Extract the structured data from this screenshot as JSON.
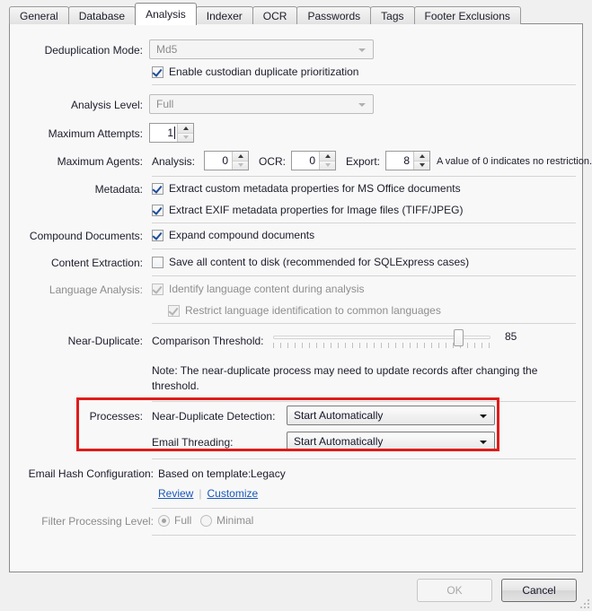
{
  "tabs": [
    {
      "label": "General",
      "selected": false
    },
    {
      "label": "Database",
      "selected": false
    },
    {
      "label": "Analysis",
      "selected": true
    },
    {
      "label": "Indexer",
      "selected": false
    },
    {
      "label": "OCR",
      "selected": false
    },
    {
      "label": "Passwords",
      "selected": false
    },
    {
      "label": "Tags",
      "selected": false
    },
    {
      "label": "Footer Exclusions",
      "selected": false
    }
  ],
  "form": {
    "deduplication": {
      "label": "Deduplication Mode:",
      "value": "Md5",
      "enabled": false
    },
    "custodian": {
      "label": "Enable custodian duplicate prioritization",
      "checked": true
    },
    "analysis_level": {
      "label": "Analysis Level:",
      "value": "Full",
      "enabled": false
    },
    "maximum_attempts": {
      "label": "Maximum Attempts:",
      "value": "1"
    },
    "maximum_agents": {
      "label": "Maximum Agents:",
      "analysis_label": "Analysis:",
      "analysis_value": "0",
      "ocr_label": "OCR:",
      "ocr_value": "0",
      "export_label": "Export:",
      "export_value": "8",
      "hint": "A value of 0 indicates no restriction."
    },
    "metadata": {
      "label": "Metadata:",
      "item1": "Extract custom metadata properties for MS Office documents",
      "item1_checked": true,
      "item2": "Extract EXIF metadata properties for Image files (TIFF/JPEG)",
      "item2_checked": true
    },
    "compound_documents": {
      "label": "Compound Documents:",
      "item1": "Expand compound documents",
      "item1_checked": true
    },
    "content_extraction": {
      "label": "Content Extraction:",
      "item1": "Save all content to disk (recommended for SQLExpress cases)",
      "item1_checked": false
    },
    "language_analysis": {
      "label": "Language Analysis:",
      "item1": "Identify language content during analysis",
      "item1_checked": true,
      "item2": "Restrict language identification to common languages",
      "item2_checked": true,
      "enabled": false
    },
    "near_duplicate": {
      "label": "Near-Duplicate:",
      "threshold_label": "Comparison Threshold:",
      "threshold_value": "85",
      "threshold_min": 0,
      "threshold_max": 100,
      "note": "Note: The near-duplicate process may need to update records after changing the threshold."
    },
    "processes": {
      "label": "Processes:",
      "near_duplicate_detection_label": "Near-Duplicate Detection:",
      "near_duplicate_detection_value": "Start Automatically",
      "email_threading_label": "Email Threading:",
      "email_threading_value": "Start Automatically",
      "highlight_color": "#e01b1b"
    },
    "email_hash": {
      "label": "Email Hash Configuration:",
      "template_label": "Based on template:",
      "template_value": "Legacy",
      "review_link": "Review",
      "customize_link": "Customize",
      "link_color": "#1a57b8"
    },
    "filter_processing": {
      "label": "Filter Processing Level:",
      "option_full": "Full",
      "option_minimal": "Minimal",
      "selected": "Full",
      "enabled": false
    }
  },
  "footer": {
    "ok_label": "OK",
    "ok_enabled": false,
    "cancel_label": "Cancel",
    "cancel_enabled": true
  }
}
